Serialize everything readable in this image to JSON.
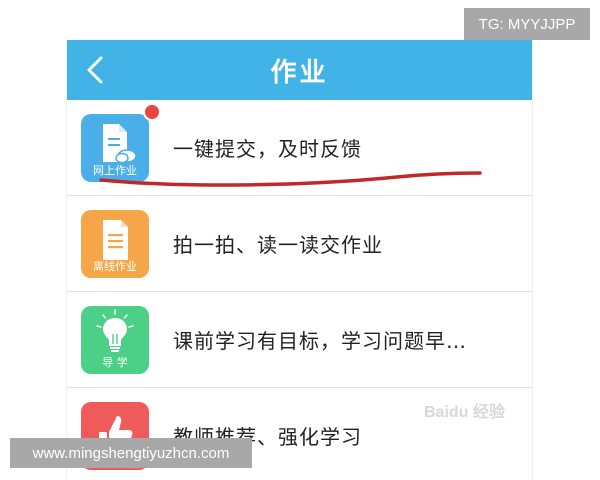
{
  "watermarks": {
    "top": "TG: MYYJJPP",
    "bottom": "www.mingshengtiyuzhcn.com",
    "baidu": "Baidu 经验"
  },
  "appbar": {
    "title": "作业",
    "back_icon": "chevron-left-icon"
  },
  "colors": {
    "appbar": "#41b3e6",
    "online": "#4aaee8",
    "offline": "#f5a648",
    "guide": "#4ccf86",
    "teacher": "#ef5a5a",
    "badge": "#e8453c",
    "annotation": "#c0282a"
  },
  "items": [
    {
      "icon_label": "网上作业",
      "icon": "cloud-document-icon",
      "text": "一键提交，及时反馈",
      "has_badge": true
    },
    {
      "icon_label": "离线作业",
      "icon": "document-icon",
      "text": "拍一拍、读一读交作业"
    },
    {
      "icon_label": "导 学",
      "icon": "lightbulb-icon",
      "text": "课前学习有目标，学习问题早…"
    },
    {
      "icon_label": "",
      "icon": "thumbs-up-icon",
      "text": "教师推荐、强化学习"
    }
  ]
}
